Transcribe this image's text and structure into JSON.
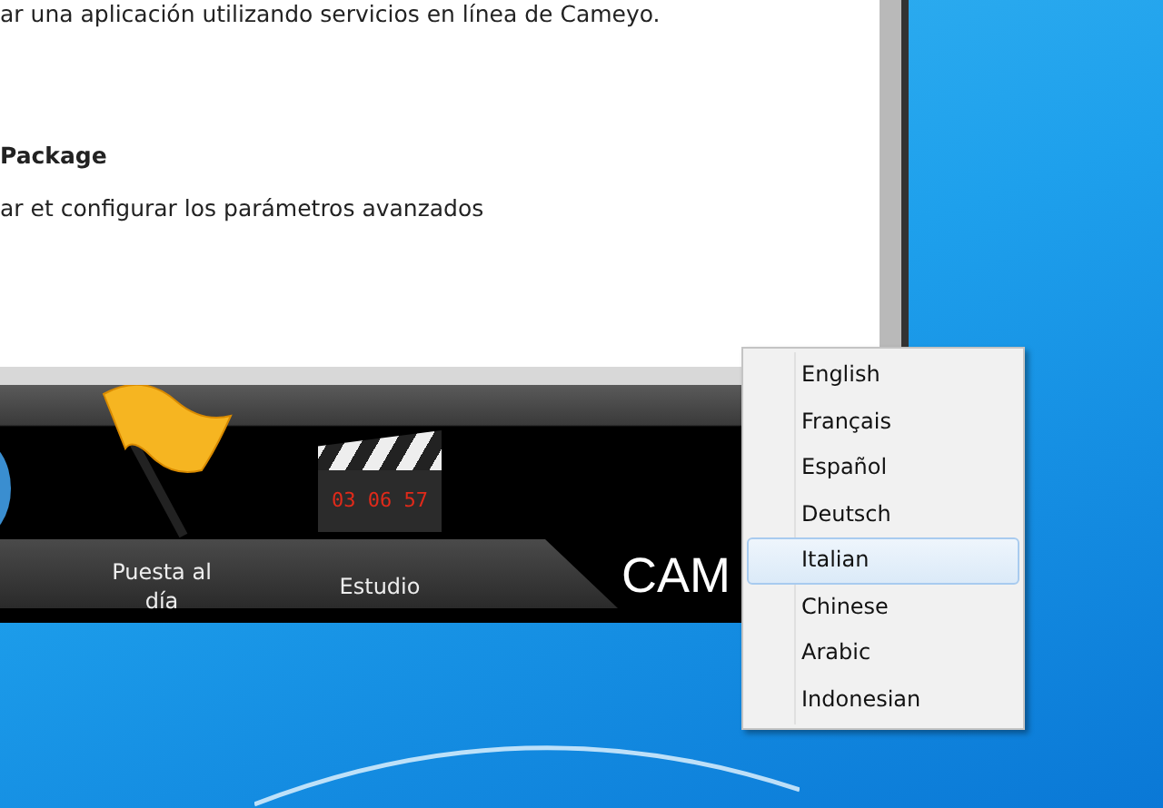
{
  "content": {
    "intro": "ar una aplicación utilizando servicios en línea de Cameyo.",
    "heading": "Package",
    "description": "ar et configurar los parámetros avanzados"
  },
  "toolbar": {
    "items": [
      {
        "kind": "flag",
        "label": "Puesta al día"
      },
      {
        "kind": "clapper",
        "label": "Estudio",
        "display": "03 06 57"
      }
    ],
    "logo": "CAM"
  },
  "language_menu": {
    "items": [
      {
        "label": "English",
        "selected": false
      },
      {
        "label": "Français",
        "selected": false
      },
      {
        "label": "Español",
        "selected": false
      },
      {
        "label": "Deutsch",
        "selected": false
      },
      {
        "label": "Italian",
        "selected": true
      },
      {
        "label": "Chinese",
        "selected": false
      },
      {
        "label": "Arabic",
        "selected": false
      },
      {
        "label": "Indonesian",
        "selected": false
      }
    ]
  }
}
